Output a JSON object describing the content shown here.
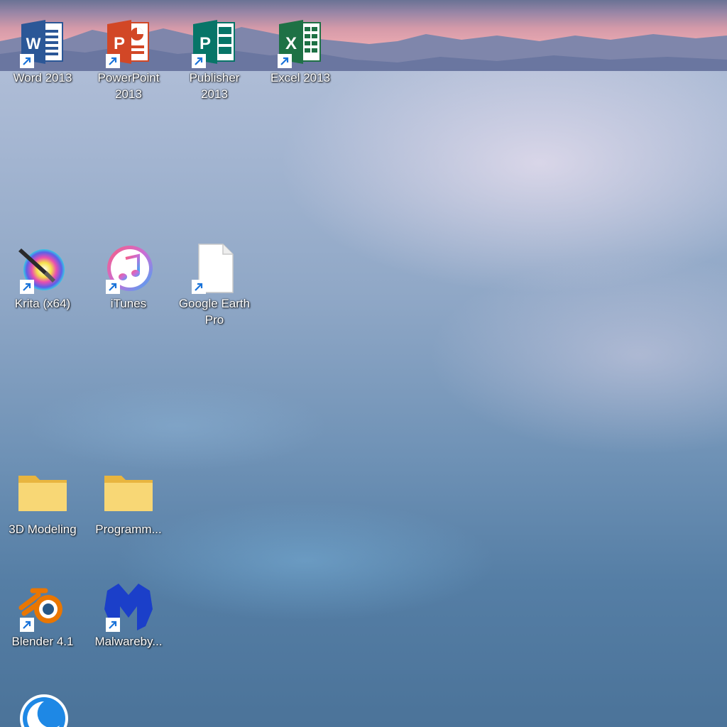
{
  "desktop": {
    "icons": [
      {
        "id": "word",
        "label": "Word 2013",
        "icon": "word-icon",
        "shortcut": true
      },
      {
        "id": "powerpoint",
        "label": "PowerPoint\n2013",
        "icon": "powerpoint-icon",
        "shortcut": true
      },
      {
        "id": "publisher",
        "label": "Publisher\n2013",
        "icon": "publisher-icon",
        "shortcut": true
      },
      {
        "id": "excel",
        "label": "Excel 2013",
        "icon": "excel-icon",
        "shortcut": true
      },
      {
        "id": "krita",
        "label": "Krita (x64)",
        "icon": "krita-icon",
        "shortcut": true
      },
      {
        "id": "itunes",
        "label": "iTunes",
        "icon": "itunes-icon",
        "shortcut": true
      },
      {
        "id": "google-earth",
        "label": "Google Earth\nPro",
        "icon": "blank-file-icon",
        "shortcut": true
      },
      {
        "id": "3d-modeling",
        "label": "3D Modeling",
        "icon": "folder-icon",
        "shortcut": false
      },
      {
        "id": "programming",
        "label": "Programm...",
        "icon": "folder-icon",
        "shortcut": false
      },
      {
        "id": "blender",
        "label": "Blender 4.1",
        "icon": "blender-icon",
        "shortcut": true
      },
      {
        "id": "malwarebytes",
        "label": "Malwareby...",
        "icon": "malwarebytes-icon",
        "shortcut": true
      },
      {
        "id": "partial-app",
        "label": "",
        "icon": "app-icon",
        "shortcut": false
      }
    ],
    "colors": {
      "word": "#2b5797",
      "powerpoint": "#d24726",
      "publisher": "#077568",
      "excel": "#1e7145",
      "folder": "#f8d775",
      "malwarebytes": "#1b3fc9",
      "blender": "#ea7600"
    }
  }
}
